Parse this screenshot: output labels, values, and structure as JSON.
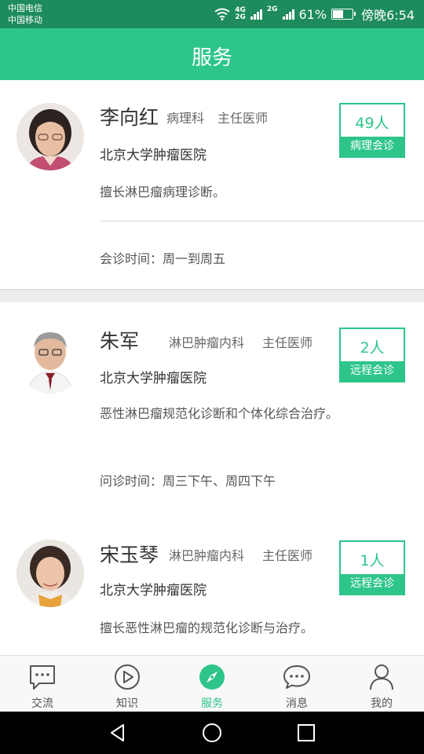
{
  "status_bar": {
    "carrier1": "中国电信",
    "carrier2": "中国移动",
    "net1": "4G",
    "net1b": "2G",
    "net2": "2G",
    "battery": "61%",
    "time": "傍晚6:54",
    "battery_level": 0.61
  },
  "header": {
    "title": "服务"
  },
  "doctors": [
    {
      "name": "李向红",
      "dept": "病理科",
      "title": "主任医师",
      "hospital": "北京大学肿瘤医院",
      "specialty": "擅长淋巴瘤病理诊断。",
      "schedule": "会诊时间：周一到周五",
      "badge_count": "49人",
      "badge_label": "病理会诊"
    },
    {
      "name": "朱军",
      "dept": "淋巴肿瘤内科",
      "title": "主任医师",
      "hospital": "北京大学肿瘤医院",
      "specialty": "恶性淋巴瘤规范化诊断和个体化综合治疗。",
      "schedule": "问诊时间：周三下午、周四下午",
      "badge_count": "2人",
      "badge_label": "远程会诊"
    },
    {
      "name": "宋玉琴",
      "dept": "淋巴肿瘤内科",
      "title": "主任医师",
      "hospital": "北京大学肿瘤医院",
      "specialty": "擅长恶性淋巴瘤的规范化诊断与治疗。",
      "badge_count": "1人",
      "badge_label": "远程会诊"
    }
  ],
  "tabs": [
    {
      "label": "交流",
      "icon": "chat-bubble-icon",
      "active": false
    },
    {
      "label": "知识",
      "icon": "play-circle-icon",
      "active": false
    },
    {
      "label": "服务",
      "icon": "compass-icon",
      "active": true
    },
    {
      "label": "消息",
      "icon": "message-icon",
      "active": false
    },
    {
      "label": "我的",
      "icon": "person-icon",
      "active": false
    }
  ],
  "colors": {
    "accent": "#2ec58a",
    "status_bar": "#1d8b5c"
  }
}
